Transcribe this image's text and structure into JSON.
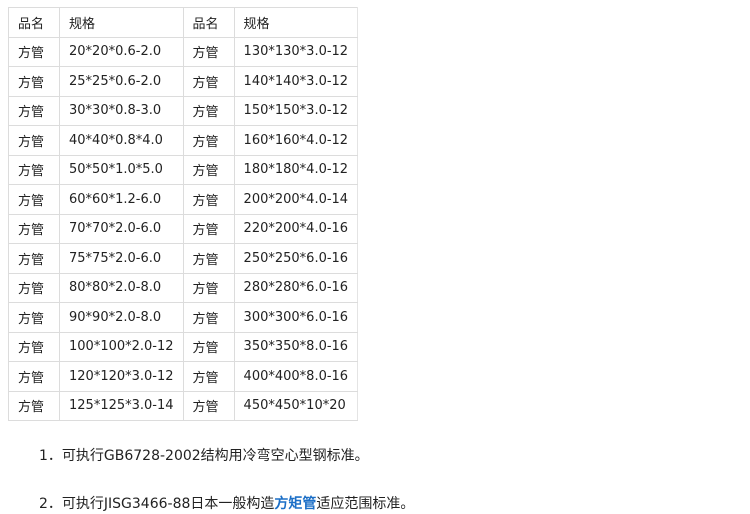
{
  "table": {
    "headers": [
      "品名",
      "规格",
      "品名",
      "规格"
    ],
    "rows": [
      [
        "方管",
        "20*20*0.6-2.0",
        "方管",
        "130*130*3.0-12"
      ],
      [
        "方管",
        "25*25*0.6-2.0",
        "方管",
        "140*140*3.0-12"
      ],
      [
        "方管",
        "30*30*0.8-3.0",
        "方管",
        "150*150*3.0-12"
      ],
      [
        "方管",
        "40*40*0.8*4.0",
        "方管",
        "160*160*4.0-12"
      ],
      [
        "方管",
        "50*50*1.0*5.0",
        "方管",
        "180*180*4.0-12"
      ],
      [
        "方管",
        "60*60*1.2-6.0",
        "方管",
        "200*200*4.0-14"
      ],
      [
        "方管",
        "70*70*2.0-6.0",
        "方管",
        "220*200*4.0-16"
      ],
      [
        "方管",
        "75*75*2.0-6.0",
        "方管",
        "250*250*6.0-16"
      ],
      [
        "方管",
        "80*80*2.0-8.0",
        "方管",
        "280*280*6.0-16"
      ],
      [
        "方管",
        "90*90*2.0-8.0",
        "方管",
        "300*300*6.0-16"
      ],
      [
        "方管",
        "100*100*2.0-12",
        "方管",
        "350*350*8.0-16"
      ],
      [
        "方管",
        "120*120*3.0-12",
        "方管",
        "400*400*8.0-16"
      ],
      [
        "方管",
        "125*125*3.0-14",
        "方管",
        "450*450*10*20"
      ]
    ]
  },
  "notes": {
    "line1": "1．可执行GB6728-2002结构用冷弯空心型钢标准。",
    "line2_prefix": "2．可执行JISG3466-88日本一般构造",
    "line2_link": "方矩管",
    "line2_suffix": "适应范围标准。"
  },
  "colors": {
    "link": "#1c6fc7",
    "border": "#dcdcdc",
    "text": "#222222"
  }
}
